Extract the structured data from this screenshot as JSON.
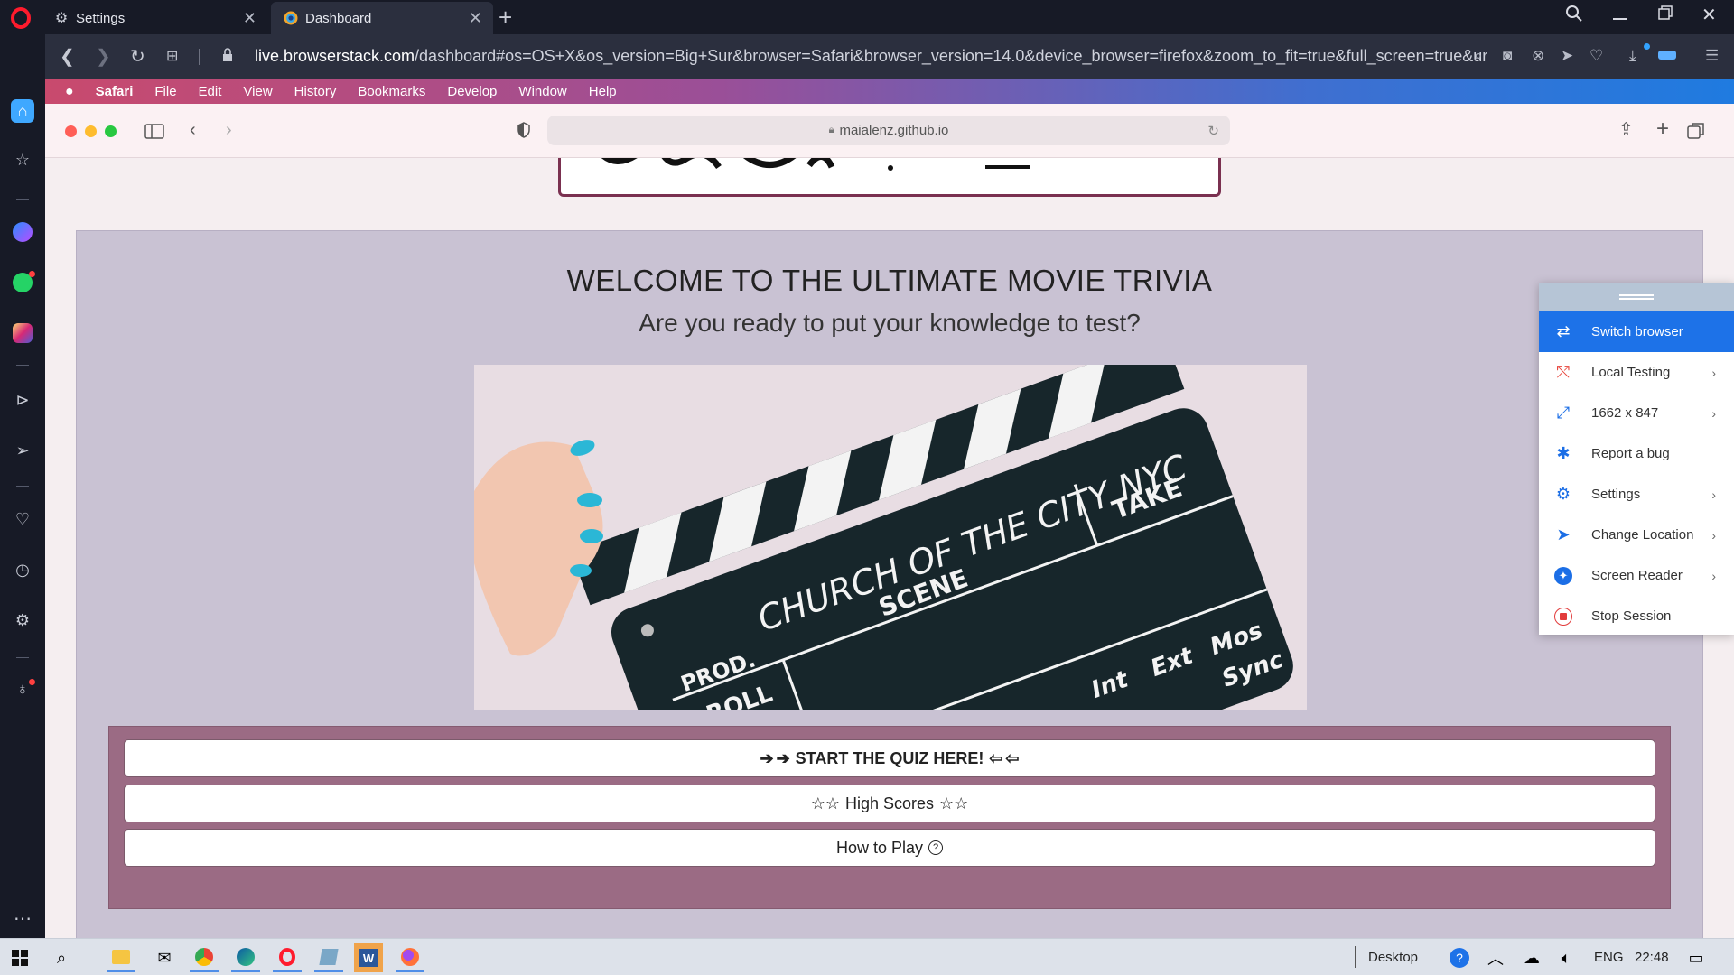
{
  "browser": {
    "tabs": [
      {
        "label": "Settings"
      },
      {
        "label": "Dashboard"
      }
    ],
    "url_host": "live.browserstack.com",
    "url_path": "/dashboard#os=OS+X&os_version=Big+Sur&browser=Safari&browser_version=14.0&device_browser=firefox&zoom_to_fit=true&full_screen=true&ur"
  },
  "mac_menu": {
    "items": [
      "Safari",
      "File",
      "Edit",
      "View",
      "History",
      "Bookmarks",
      "Develop",
      "Window",
      "Help"
    ]
  },
  "safari": {
    "address": "maialenz.github.io"
  },
  "page": {
    "title": "WELCOME TO THE ULTIMATE MOVIE TRIVIA",
    "subtitle": "Are you ready to put your knowledge to test?",
    "clapper": {
      "line1": "CHURCH OF THE CITY NYC",
      "prod": "PROD.",
      "roll": "ROLL",
      "scene": "SCENE",
      "take": "TAKE",
      "int": "Int",
      "ext": "Ext",
      "mos": "Mos",
      "sync": "Sync"
    },
    "buttons": {
      "start": "START THE QUIZ HERE!",
      "scores": "High Scores",
      "howto": "How to Play"
    }
  },
  "bs_panel": {
    "items": [
      {
        "label": "Switch browser",
        "icon": "switch-icon",
        "chevron": false
      },
      {
        "label": "Local Testing",
        "icon": "local-testing-icon",
        "chevron": true
      },
      {
        "label": "1662 x 847",
        "icon": "resize-icon",
        "chevron": true
      },
      {
        "label": "Report a bug",
        "icon": "bug-icon",
        "chevron": false
      },
      {
        "label": "Settings",
        "icon": "settings-icon",
        "chevron": true
      },
      {
        "label": "Change Location",
        "icon": "location-icon",
        "chevron": true
      },
      {
        "label": "Screen Reader",
        "icon": "accessibility-icon",
        "chevron": true
      },
      {
        "label": "Stop Session",
        "icon": "stop-icon",
        "chevron": false
      }
    ]
  },
  "taskbar": {
    "desktop_label": "Desktop",
    "language": "ENG",
    "time": "22:48"
  },
  "colors": {
    "accent": "#1d72e8",
    "opera_red": "#ff1b2d",
    "button_frame": "#9b6b84"
  }
}
